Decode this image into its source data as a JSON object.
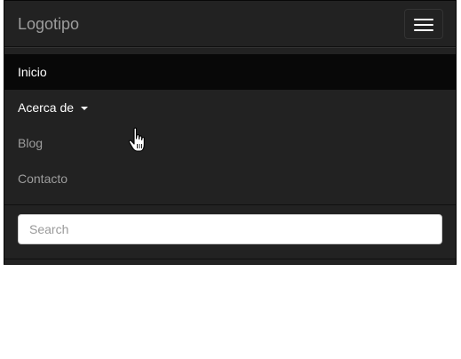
{
  "navbar": {
    "brand": "Logotipo",
    "menu_icon": "hamburger-menu-icon",
    "items": [
      {
        "label": "Inicio",
        "state": "active"
      },
      {
        "label": "Acerca de",
        "state": "open",
        "dropdown": true
      },
      {
        "label": "Blog",
        "state": "normal"
      },
      {
        "label": "Contacto",
        "state": "normal"
      }
    ],
    "search": {
      "placeholder": "Search",
      "value": ""
    }
  },
  "cursor": {
    "icon": "hand-pointer-icon"
  },
  "colors": {
    "navbar_bg": "#222222",
    "active_bg": "#080808",
    "text_muted": "#9d9d9d",
    "text_active": "#ffffff"
  }
}
